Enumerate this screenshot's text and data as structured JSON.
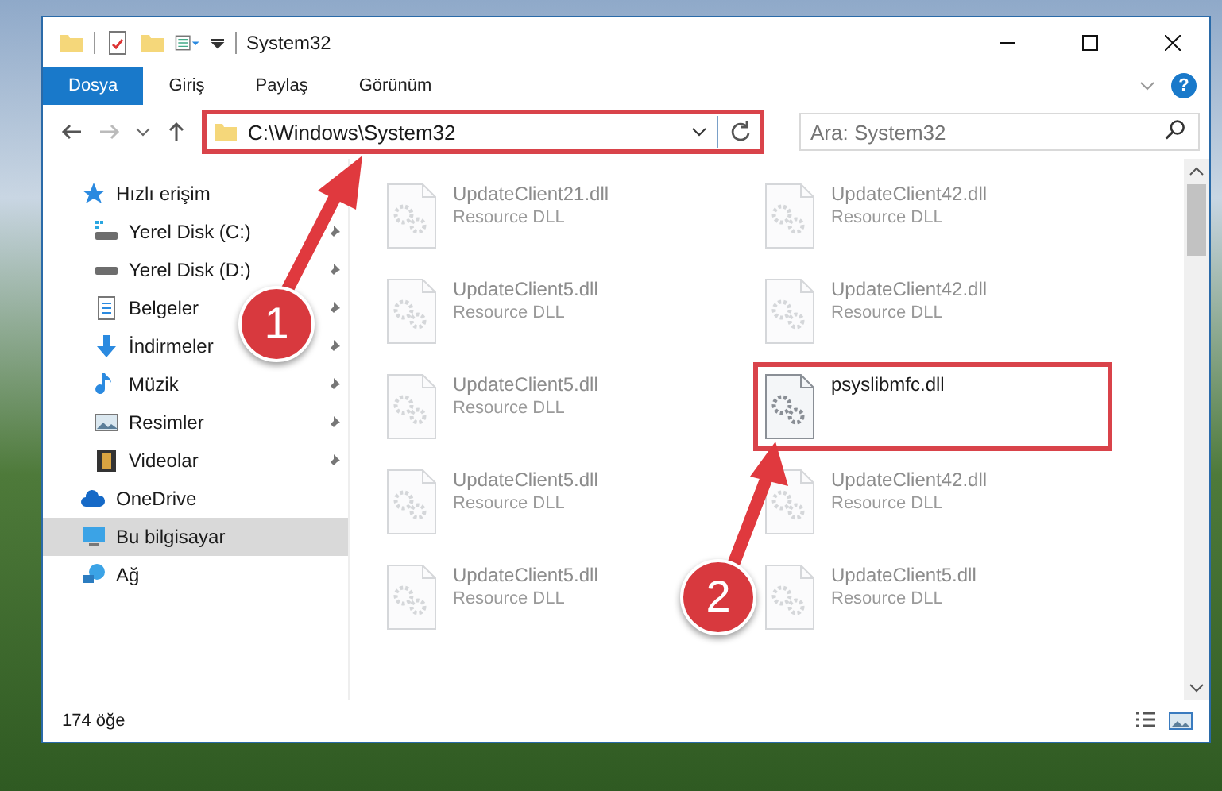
{
  "window": {
    "title": "System32"
  },
  "ribbon": {
    "tabs": [
      {
        "label": "Dosya",
        "selected": true
      },
      {
        "label": "Giriş",
        "selected": false
      },
      {
        "label": "Paylaş",
        "selected": false
      },
      {
        "label": "Görünüm",
        "selected": false
      }
    ],
    "help": "?"
  },
  "address_bar": {
    "path": "C:\\Windows\\System32",
    "highlighted": true
  },
  "search": {
    "placeholder": "Ara: System32"
  },
  "sidebar": {
    "items": [
      {
        "label": "Hızlı erişim",
        "kind": "star",
        "selected": false,
        "children": [
          {
            "label": "Yerel Disk (C:)",
            "kind": "system-drive",
            "pinned": true
          },
          {
            "label": "Yerel Disk (D:)",
            "kind": "drive",
            "pinned": true
          },
          {
            "label": "Belgeler",
            "kind": "documents",
            "pinned": true
          },
          {
            "label": "İndirmeler",
            "kind": "download",
            "pinned": true
          },
          {
            "label": "Müzik",
            "kind": "music",
            "pinned": true
          },
          {
            "label": "Resimler",
            "kind": "pictures",
            "pinned": true
          },
          {
            "label": "Videolar",
            "kind": "videos",
            "pinned": true
          }
        ]
      },
      {
        "label": "OneDrive",
        "kind": "cloud",
        "selected": false
      },
      {
        "label": "Bu bilgisayar",
        "kind": "computer",
        "selected": true
      },
      {
        "label": "Ağ",
        "kind": "network",
        "selected": false
      }
    ]
  },
  "files": [
    {
      "name": "UpdateClient21.dll",
      "type": "Resource DLL",
      "dimmed": true,
      "highlighted": false
    },
    {
      "name": "UpdateClient42.dll",
      "type": "Resource DLL",
      "dimmed": true,
      "highlighted": false
    },
    {
      "name": "UpdateClient5.dll",
      "type": "Resource DLL",
      "dimmed": true,
      "highlighted": false
    },
    {
      "name": "UpdateClient42.dll",
      "type": "Resource DLL",
      "dimmed": true,
      "highlighted": false
    },
    {
      "name": "UpdateClient5.dll",
      "type": "Resource DLL",
      "dimmed": true,
      "highlighted": false
    },
    {
      "name": "psyslibmfc.dll",
      "dimmed": false,
      "highlighted": true
    },
    {
      "name": "UpdateClient5.dll",
      "type": "Resource DLL",
      "dimmed": true,
      "highlighted": false
    },
    {
      "name": "UpdateClient42.dll",
      "type": "Resource DLL",
      "dimmed": true,
      "highlighted": false
    },
    {
      "name": "UpdateClient5.dll",
      "type": "Resource DLL",
      "dimmed": true,
      "highlighted": false
    },
    {
      "name": "UpdateClient5.dll",
      "type": "Resource DLL",
      "dimmed": true,
      "highlighted": false
    }
  ],
  "status_bar": {
    "count": "174 öğe"
  },
  "callouts": [
    "1",
    "2"
  ]
}
